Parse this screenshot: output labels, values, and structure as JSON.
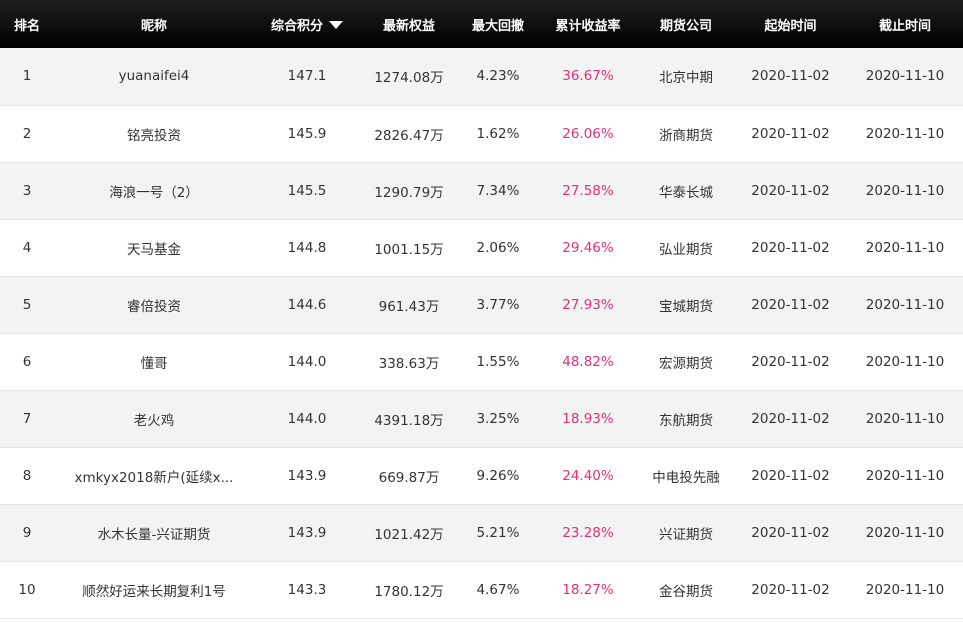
{
  "headers": {
    "rank": "排名",
    "nickname": "昵称",
    "score": "综合积分",
    "equity": "最新权益",
    "drawdown": "最大回撤",
    "return": "累计收益率",
    "broker": "期货公司",
    "start": "起始时间",
    "end": "截止时间"
  },
  "sort": {
    "column": "score",
    "direction": "desc",
    "icon": "sort-desc-triangle-icon"
  },
  "colors": {
    "header_bg": "#000000",
    "return_text": "#e0307a",
    "row_alt": "#f3f3f3"
  },
  "rows": [
    {
      "rank": "1",
      "nickname": "yuanaifei4",
      "score": "147.1",
      "equity": "1274.08万",
      "drawdown": "4.23%",
      "return": "36.67%",
      "broker": "北京中期",
      "start": "2020-11-02",
      "end": "2020-11-10"
    },
    {
      "rank": "2",
      "nickname": "铭亮投资",
      "score": "145.9",
      "equity": "2826.47万",
      "drawdown": "1.62%",
      "return": "26.06%",
      "broker": "浙商期货",
      "start": "2020-11-02",
      "end": "2020-11-10"
    },
    {
      "rank": "3",
      "nickname": "海浪一号（2）",
      "score": "145.5",
      "equity": "1290.79万",
      "drawdown": "7.34%",
      "return": "27.58%",
      "broker": "华泰长城",
      "start": "2020-11-02",
      "end": "2020-11-10"
    },
    {
      "rank": "4",
      "nickname": "天马基金",
      "score": "144.8",
      "equity": "1001.15万",
      "drawdown": "2.06%",
      "return": "29.46%",
      "broker": "弘业期货",
      "start": "2020-11-02",
      "end": "2020-11-10"
    },
    {
      "rank": "5",
      "nickname": "睿倍投资",
      "score": "144.6",
      "equity": "961.43万",
      "drawdown": "3.77%",
      "return": "27.93%",
      "broker": "宝城期货",
      "start": "2020-11-02",
      "end": "2020-11-10"
    },
    {
      "rank": "6",
      "nickname": "懂哥",
      "score": "144.0",
      "equity": "338.63万",
      "drawdown": "1.55%",
      "return": "48.82%",
      "broker": "宏源期货",
      "start": "2020-11-02",
      "end": "2020-11-10"
    },
    {
      "rank": "7",
      "nickname": "老火鸡",
      "score": "144.0",
      "equity": "4391.18万",
      "drawdown": "3.25%",
      "return": "18.93%",
      "broker": "东航期货",
      "start": "2020-11-02",
      "end": "2020-11-10"
    },
    {
      "rank": "8",
      "nickname": "xmkyx2018新户(延续x...",
      "score": "143.9",
      "equity": "669.87万",
      "drawdown": "9.26%",
      "return": "24.40%",
      "broker": "中电投先融",
      "start": "2020-11-02",
      "end": "2020-11-10"
    },
    {
      "rank": "9",
      "nickname": "水木长量-兴证期货",
      "score": "143.9",
      "equity": "1021.42万",
      "drawdown": "5.21%",
      "return": "23.28%",
      "broker": "兴证期货",
      "start": "2020-11-02",
      "end": "2020-11-10"
    },
    {
      "rank": "10",
      "nickname": "顺然好运来长期复利1号",
      "score": "143.3",
      "equity": "1780.12万",
      "drawdown": "4.67%",
      "return": "18.27%",
      "broker": "金谷期货",
      "start": "2020-11-02",
      "end": "2020-11-10"
    }
  ]
}
